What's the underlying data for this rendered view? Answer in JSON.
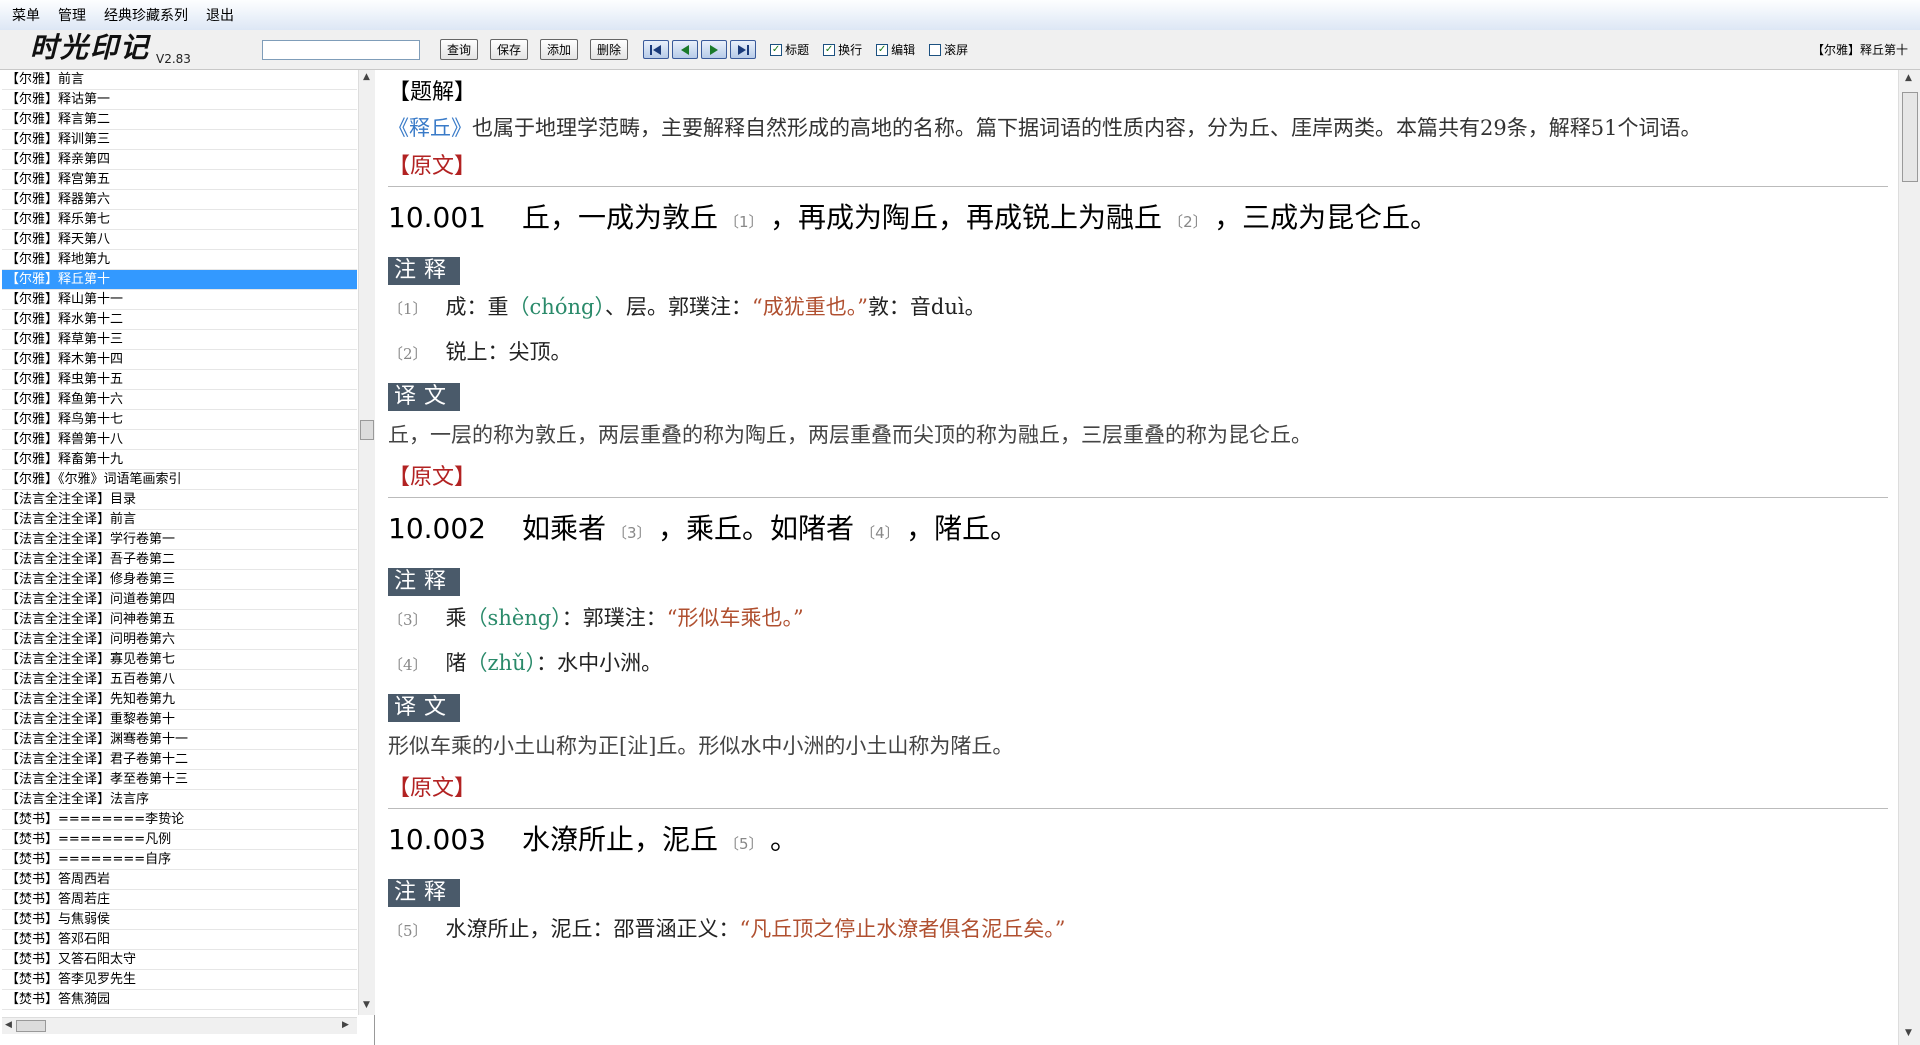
{
  "menu": [
    "菜单",
    "管理",
    "经典珍藏系列",
    "退出"
  ],
  "toolbar": {
    "logo": "时光印记",
    "version": "V2.83",
    "search_value": "",
    "buttons": [
      "查询",
      "保存",
      "添加",
      "删除"
    ],
    "checkboxes": [
      {
        "label": "标题",
        "checked": true
      },
      {
        "label": "换行",
        "checked": true
      },
      {
        "label": "编辑",
        "checked": true
      },
      {
        "label": "滚屏",
        "checked": false
      }
    ],
    "current_chapter": "【尔雅】释丘第十"
  },
  "sidebar": {
    "selected_index": 10,
    "items": [
      "【尔雅】前言",
      "【尔雅】释诂第一",
      "【尔雅】释言第二",
      "【尔雅】释训第三",
      "【尔雅】释亲第四",
      "【尔雅】释宫第五",
      "【尔雅】释器第六",
      "【尔雅】释乐第七",
      "【尔雅】释天第八",
      "【尔雅】释地第九",
      "【尔雅】释丘第十",
      "【尔雅】释山第十一",
      "【尔雅】释水第十二",
      "【尔雅】释草第十三",
      "【尔雅】释木第十四",
      "【尔雅】释虫第十五",
      "【尔雅】释鱼第十六",
      "【尔雅】释鸟第十七",
      "【尔雅】释兽第十八",
      "【尔雅】释畜第十九",
      "【尔雅】《尔雅》词语笔画索引",
      "【法言全注全译】目录",
      "【法言全注全译】前言",
      "【法言全注全译】学行卷第一",
      "【法言全注全译】吾子卷第二",
      "【法言全注全译】修身卷第三",
      "【法言全注全译】问道卷第四",
      "【法言全注全译】问神卷第五",
      "【法言全注全译】问明卷第六",
      "【法言全注全译】寡见卷第七",
      "【法言全注全译】五百卷第八",
      "【法言全注全译】先知卷第九",
      "【法言全注全译】重黎卷第十",
      "【法言全注全译】渊骞卷第十一",
      "【法言全注全译】君子卷第十二",
      "【法言全注全译】孝至卷第十三",
      "【法言全注全译】法言序",
      "【焚书】========李贽论",
      "【焚书】========凡例",
      "【焚书】========自序",
      "【焚书】答周西岩",
      "【焚书】答周若庄",
      "【焚书】与焦弱侯",
      "【焚书】答邓石阳",
      "【焚书】又答石阳太守",
      "【焚书】答李见罗先生",
      "【焚书】答焦漪园"
    ]
  },
  "content": {
    "intro_head": "【题解】",
    "intro_book": "《释丘》",
    "intro_text": "也属于地理学范畴，主要解释自然形成的高地的名称。篇下据词语的性质内容，分为丘、厓岸两类。本篇共有29条，解释51个词语。",
    "original_head": "【原文】",
    "notes_label": "注释",
    "trans_label": "译文",
    "entries": [
      {
        "num": "10.001",
        "parts": [
          "丘，一成为敦丘",
          "〔1〕",
          "，再成为陶丘，再成锐上为融丘",
          "〔2〕",
          "，三成为昆仑丘。"
        ],
        "notes": [
          {
            "ref": "〔1〕",
            "a": "成：重",
            "pinyin": "（chóng）",
            "b": "、层。郭璞注：",
            "quote": "“成犹重也。”",
            "c": "敦：音duì。"
          },
          {
            "ref": "〔2〕",
            "a": "锐上：尖顶。",
            "pinyin": "",
            "b": "",
            "quote": "",
            "c": ""
          }
        ],
        "translation": "丘，一层的称为敦丘，两层重叠的称为陶丘，两层重叠而尖顶的称为融丘，三层重叠的称为昆仑丘。"
      },
      {
        "num": "10.002",
        "parts": [
          "如乘者",
          "〔3〕",
          "，乘丘。如陼者",
          "〔4〕",
          "，陼丘。"
        ],
        "notes": [
          {
            "ref": "〔3〕",
            "a": "乘",
            "pinyin": "（shèng）",
            "b": "：郭璞注：",
            "quote": "“形似车乘也。”",
            "c": ""
          },
          {
            "ref": "〔4〕",
            "a": "陼",
            "pinyin": "（zhǔ）",
            "b": "：水中小洲。",
            "quote": "",
            "c": ""
          }
        ],
        "translation": "形似车乘的小土山称为正[沚]丘。形似水中小洲的小土山称为陼丘。"
      },
      {
        "num": "10.003",
        "parts": [
          "水潦所止，泥丘",
          "〔5〕",
          "。",
          "",
          ""
        ],
        "notes": [
          {
            "ref": "〔5〕",
            "a": "水潦所止，泥丘：邵晋涵正义：",
            "pinyin": "",
            "b": "",
            "quote": "“凡丘顶之停止水潦者俱名泥丘矣。”",
            "c": ""
          }
        ],
        "translation": ""
      }
    ]
  }
}
